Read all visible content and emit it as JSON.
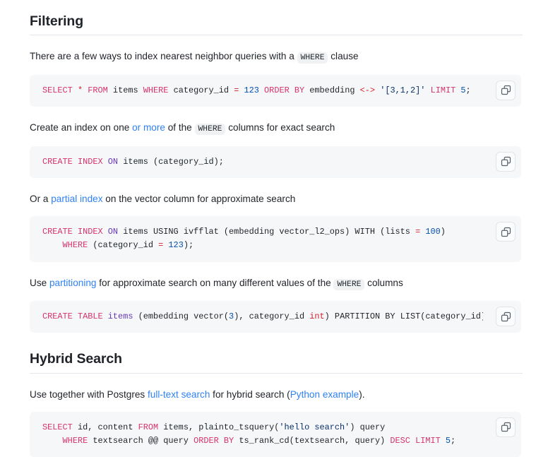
{
  "sections": [
    {
      "heading": "Filtering",
      "blocks": [
        {
          "type": "paragraph",
          "parts": [
            {
              "kind": "text",
              "text": "There are a few ways to index nearest neighbor queries with a "
            },
            {
              "kind": "code",
              "text": "WHERE"
            },
            {
              "kind": "text",
              "text": " clause"
            }
          ]
        },
        {
          "type": "code",
          "copy_label": "copy-icon",
          "lines": [
            [
              {
                "t": "kw",
                "s": "SELECT"
              },
              {
                "t": "plain",
                "s": " "
              },
              {
                "t": "op",
                "s": "*"
              },
              {
                "t": "plain",
                "s": " "
              },
              {
                "t": "kw",
                "s": "FROM"
              },
              {
                "t": "plain",
                "s": " items "
              },
              {
                "t": "kw",
                "s": "WHERE"
              },
              {
                "t": "plain",
                "s": " category_id "
              },
              {
                "t": "op",
                "s": "="
              },
              {
                "t": "plain",
                "s": " "
              },
              {
                "t": "num",
                "s": "123"
              },
              {
                "t": "plain",
                "s": " "
              },
              {
                "t": "kw",
                "s": "ORDER BY"
              },
              {
                "t": "plain",
                "s": " embedding "
              },
              {
                "t": "op",
                "s": "<->"
              },
              {
                "t": "plain",
                "s": " "
              },
              {
                "t": "str",
                "s": "'[3,1,2]'"
              },
              {
                "t": "plain",
                "s": " "
              },
              {
                "t": "kw",
                "s": "LIMIT"
              },
              {
                "t": "plain",
                "s": " "
              },
              {
                "t": "num",
                "s": "5"
              },
              {
                "t": "plain",
                "s": ";"
              }
            ]
          ]
        },
        {
          "type": "paragraph",
          "parts": [
            {
              "kind": "text",
              "text": "Create an index on one "
            },
            {
              "kind": "link",
              "text": "or more"
            },
            {
              "kind": "text",
              "text": " of the "
            },
            {
              "kind": "code",
              "text": "WHERE"
            },
            {
              "kind": "text",
              "text": " columns for exact search"
            }
          ]
        },
        {
          "type": "code",
          "copy_label": "copy-icon",
          "lines": [
            [
              {
                "t": "kw",
                "s": "CREATE INDEX"
              },
              {
                "t": "plain",
                "s": " "
              },
              {
                "t": "name",
                "s": "ON"
              },
              {
                "t": "plain",
                "s": " items (category_id);"
              }
            ]
          ]
        },
        {
          "type": "paragraph",
          "parts": [
            {
              "kind": "text",
              "text": "Or a "
            },
            {
              "kind": "link",
              "text": "partial index"
            },
            {
              "kind": "text",
              "text": " on the vector column for approximate search"
            }
          ]
        },
        {
          "type": "code",
          "copy_label": "copy-icon",
          "lines": [
            [
              {
                "t": "kw",
                "s": "CREATE INDEX"
              },
              {
                "t": "plain",
                "s": " "
              },
              {
                "t": "name",
                "s": "ON"
              },
              {
                "t": "plain",
                "s": " items USING ivfflat (embedding vector_l2_ops) WITH (lists "
              },
              {
                "t": "op",
                "s": "="
              },
              {
                "t": "plain",
                "s": " "
              },
              {
                "t": "num",
                "s": "100"
              },
              {
                "t": "plain",
                "s": ")"
              }
            ],
            [
              {
                "t": "plain",
                "s": "    "
              },
              {
                "t": "kw",
                "s": "WHERE"
              },
              {
                "t": "plain",
                "s": " (category_id "
              },
              {
                "t": "op",
                "s": "="
              },
              {
                "t": "plain",
                "s": " "
              },
              {
                "t": "num",
                "s": "123"
              },
              {
                "t": "plain",
                "s": ");"
              }
            ]
          ]
        },
        {
          "type": "paragraph",
          "parts": [
            {
              "kind": "text",
              "text": "Use "
            },
            {
              "kind": "link",
              "text": "partitioning"
            },
            {
              "kind": "text",
              "text": " for approximate search on many different values of the "
            },
            {
              "kind": "code",
              "text": "WHERE"
            },
            {
              "kind": "text",
              "text": " columns"
            }
          ]
        },
        {
          "type": "code",
          "copy_label": "copy-icon",
          "lines": [
            [
              {
                "t": "kw",
                "s": "CREATE TABLE"
              },
              {
                "t": "plain",
                "s": " "
              },
              {
                "t": "name",
                "s": "items"
              },
              {
                "t": "plain",
                "s": " (embedding vector("
              },
              {
                "t": "num",
                "s": "3"
              },
              {
                "t": "plain",
                "s": "), category_id "
              },
              {
                "t": "kw2",
                "s": "int"
              },
              {
                "t": "plain",
                "s": ") PARTITION BY LIST(category_id);"
              }
            ]
          ]
        }
      ]
    },
    {
      "heading": "Hybrid Search",
      "blocks": [
        {
          "type": "paragraph",
          "parts": [
            {
              "kind": "text",
              "text": "Use together with Postgres "
            },
            {
              "kind": "link",
              "text": "full-text search"
            },
            {
              "kind": "text",
              "text": " for hybrid search ("
            },
            {
              "kind": "link",
              "text": "Python example"
            },
            {
              "kind": "text",
              "text": ")."
            }
          ]
        },
        {
          "type": "code",
          "copy_label": "copy-icon",
          "lines": [
            [
              {
                "t": "kw",
                "s": "SELECT"
              },
              {
                "t": "plain",
                "s": " id, content "
              },
              {
                "t": "kw",
                "s": "FROM"
              },
              {
                "t": "plain",
                "s": " items, plainto_tsquery("
              },
              {
                "t": "str",
                "s": "'hello search'"
              },
              {
                "t": "plain",
                "s": ") query"
              }
            ],
            [
              {
                "t": "plain",
                "s": "    "
              },
              {
                "t": "kw",
                "s": "WHERE"
              },
              {
                "t": "plain",
                "s": " textsearch @@ query "
              },
              {
                "t": "kw",
                "s": "ORDER BY"
              },
              {
                "t": "plain",
                "s": " ts_rank_cd(textsearch, query) "
              },
              {
                "t": "kw",
                "s": "DESC LIMIT"
              },
              {
                "t": "plain",
                "s": " "
              },
              {
                "t": "num",
                "s": "5"
              },
              {
                "t": "plain",
                "s": ";"
              }
            ]
          ]
        }
      ]
    }
  ],
  "colors": {
    "link": "#2f81f7",
    "keyword": "#d6336c",
    "number": "#0550ae",
    "string": "#0a3069",
    "name": "#6639ba",
    "code_background": "#f6f7f9",
    "inline_code_background": "#eff1f3",
    "text": "#1f2328"
  }
}
